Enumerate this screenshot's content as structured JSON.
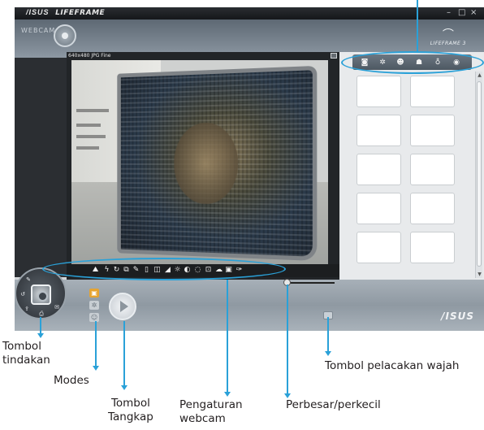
{
  "window": {
    "brand": "/ISUS",
    "app_title": "LIFEFRAME",
    "minimize_glyph": "–",
    "restore_glyph": "□",
    "close_glyph": "×"
  },
  "header": {
    "tab_label": "WEBCAM",
    "logo_text": "LIFEFRAME",
    "logo_badge": "3"
  },
  "preview": {
    "resolution_label": "640x480 JPG Fine"
  },
  "webcam_toolbar": {
    "icons": [
      "person-icon",
      "flash-icon",
      "timer-icon",
      "frames-icon",
      "pen-icon",
      "frame-icon",
      "effect-icon",
      "brightness-icon",
      "contrast-icon",
      "saturation-icon",
      "white-balance-icon",
      "sharpness-icon",
      "color-icon",
      "settings-icon",
      "wrench-icon"
    ]
  },
  "right_toolbar": {
    "icons": [
      "camera-icon",
      "gear-icon",
      "face-icon",
      "hand-icon",
      "mic-icon",
      "eye-icon"
    ]
  },
  "footer": {
    "asus_logo": "/ISUS"
  },
  "annotations": {
    "action_button": [
      "Tombol",
      "tindakan"
    ],
    "modes": "Modes",
    "capture_button": [
      "Tombol",
      "Tangkap"
    ],
    "webcam_settings": [
      "Pengaturan",
      "webcam"
    ],
    "zoom": "Perbesar/perkecil",
    "face_tracking": "Tombol pelacakan wajah"
  },
  "colors": {
    "callout": "#2aa1d8",
    "titlebar": "#1f2226",
    "panel_bg": "#e8eaec"
  }
}
